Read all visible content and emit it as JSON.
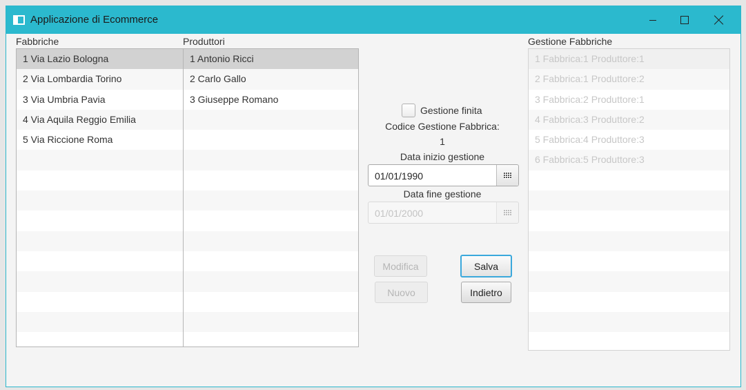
{
  "window": {
    "title": "Applicazione di Ecommerce"
  },
  "fabbriche": {
    "label": "Fabbriche",
    "items": [
      "1 Via Lazio Bologna",
      "2 Via Lombardia Torino",
      "3 Via Umbria Pavia",
      "4 Via Aquila Reggio Emilia",
      "5 Via Riccione Roma"
    ],
    "selected_index": 0
  },
  "produttori": {
    "label": "Produttori",
    "items": [
      "1 Antonio Ricci",
      "2 Carlo Gallo",
      "3 Giuseppe Romano"
    ],
    "selected_index": 0
  },
  "form": {
    "checkbox_label": "Gestione finita",
    "checkbox_checked": false,
    "codice_label": "Codice Gestione Fabbrica:",
    "codice_value": "1",
    "data_inizio_label": "Data inizio gestione",
    "data_inizio_value": "01/01/1990",
    "data_fine_label": "Data fine gestione",
    "data_fine_value": "01/01/2000"
  },
  "buttons": {
    "modifica": "Modifica",
    "nuovo": "Nuovo",
    "salva": "Salva",
    "indietro": "Indietro"
  },
  "gestione": {
    "label": "Gestione Fabbriche",
    "items": [
      "1 Fabbrica:1 Produttore:1",
      "2 Fabbrica:1 Produttore:2",
      "3 Fabbrica:2 Produttore:1",
      "4 Fabbrica:3 Produttore:2",
      "5 Fabbrica:4 Produttore:3",
      "6 Fabbrica:5 Produttore:3"
    ],
    "selected_index": 0
  },
  "icons": {
    "app": "window-icon",
    "minimize": "minimize-icon",
    "maximize": "maximize-icon",
    "close": "close-icon",
    "calendar": "calendar-icon"
  },
  "colors": {
    "titlebar": "#2bb9ce",
    "focus": "#3aa8dc"
  }
}
